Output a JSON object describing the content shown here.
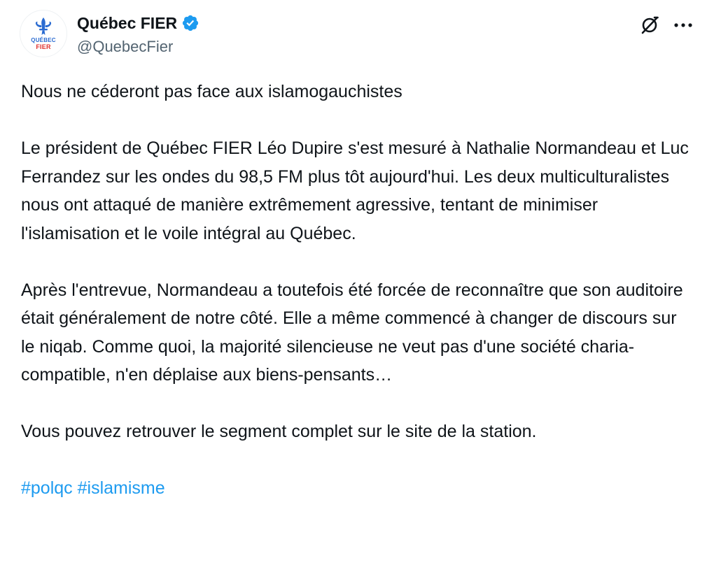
{
  "author": {
    "display_name": "Québec FIER",
    "handle": "@QuebecFier",
    "verified_icon": "verified-badge-icon",
    "avatar_logo": {
      "line1": "QUÉBEC",
      "line2": "FIER"
    }
  },
  "actions": {
    "grok_icon": "grok-icon",
    "more_icon": "more-options-icon"
  },
  "tweet": {
    "paragraphs": [
      "Nous ne céderont pas face aux islamogauchistes",
      "Le président de Québec FIER Léo Dupire s'est mesuré à Nathalie Normandeau et Luc Ferrandez sur les ondes du 98,5 FM plus tôt aujourd'hui. Les deux multiculturalistes nous ont attaqué de manière extrêmement agressive, tentant de minimiser l'islamisation et le voile intégral au Québec.",
      "Après l'entrevue, Normandeau a toutefois été forcée de reconnaître que son auditoire était généralement de notre côté. Elle a même commencé à changer de discours sur le niqab. Comme quoi, la majorité silencieuse ne veut pas d'une société charia-compatible, n'en déplaise aux biens-pensants…",
      "Vous pouvez retrouver le segment complet sur le site de la station."
    ],
    "hashtags": [
      "#polqc",
      "#islamisme"
    ]
  },
  "colors": {
    "text": "#0f1419",
    "secondary": "#536471",
    "link": "#1d9bf0",
    "verified": "#1d9bf0",
    "logo_blue": "#2a6bd1",
    "logo_red": "#e0332f"
  }
}
